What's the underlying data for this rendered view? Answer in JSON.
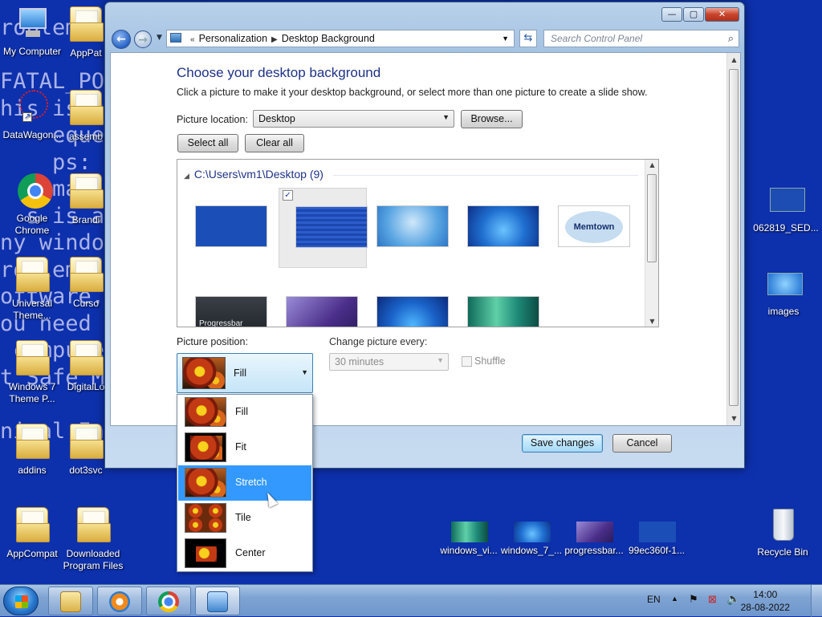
{
  "wallpaper": {
    "lines": [
      "roblem has b              n d           revent",
      "                                           .",
      "FATAL_POO",
      "his is the                                ",
      "    eque you",
      "    ps:",
      "  t ma                                talled.",
      "  s is a                              nufactur",
      "ny windo",
      "roblems co                            rdware",
      "oftware.                              dowing.",
      "ou need t                             estart",
      " c mputer,                            then",
      "t Safe Mode.",
      "",
      "nical Informati"
    ]
  },
  "desktop_icons": [
    {
      "label": "My Computer",
      "icon": "computer-icon"
    },
    {
      "label": "AppPat",
      "icon": "folder-icon"
    },
    {
      "label": "DataWagon...",
      "icon": "shortcut-icon"
    },
    {
      "label": "assemb",
      "icon": "folder-icon"
    },
    {
      "label": "Google Chrome",
      "icon": "chrome-icon"
    },
    {
      "label": "Brandi",
      "icon": "folder-icon"
    },
    {
      "label": "Universal Theme...",
      "icon": "folder-icon"
    },
    {
      "label": "Curso",
      "icon": "folder-icon"
    },
    {
      "label": "Windows 7 Theme P...",
      "icon": "folder-icon"
    },
    {
      "label": "DigitalLo",
      "icon": "folder-icon"
    },
    {
      "label": "addins",
      "icon": "folder-icon"
    },
    {
      "label": "dot3svc",
      "icon": "folder-icon"
    },
    {
      "label": "AppCompat",
      "icon": "folder-icon"
    },
    {
      "label": "Downloaded Program Files",
      "icon": "folder-icon"
    },
    {
      "label": "062819_SED...",
      "icon": "image-file-icon"
    },
    {
      "label": "images",
      "icon": "image-file-icon"
    },
    {
      "label": "windows_vi...",
      "icon": "image-file-icon"
    },
    {
      "label": "windows_7_...",
      "icon": "image-file-icon"
    },
    {
      "label": "progressbar...",
      "icon": "image-file-icon"
    },
    {
      "label": "99ec360f-1...",
      "icon": "image-file-icon"
    },
    {
      "label": "Recycle Bin",
      "icon": "recycle-bin-icon"
    }
  ],
  "window": {
    "breadcrumb": [
      "Personalization",
      "Desktop Background"
    ],
    "search_placeholder": "Search Control Panel",
    "heading": "Choose your desktop background",
    "subtext": "Click a picture to make it your desktop background, or select more than one picture to create a slide show.",
    "picture_location_label": "Picture location:",
    "picture_location_value": "Desktop",
    "browse_label": "Browse...",
    "select_all_label": "Select all",
    "clear_all_label": "Clear all",
    "gallery_group": "C:\\Users\\vm1\\Desktop (9)",
    "gallery_items": [
      {
        "style": "bsod",
        "checked": false
      },
      {
        "style": "bsod2",
        "checked": true
      },
      {
        "style": "blue",
        "checked": false
      },
      {
        "style": "win7",
        "checked": false
      },
      {
        "style": "memtown",
        "checked": false,
        "caption": "Memtown"
      },
      {
        "style": "dark",
        "checked": false,
        "caption": "Progressbar"
      },
      {
        "style": "purple",
        "checked": false
      },
      {
        "style": "win7b",
        "checked": false
      },
      {
        "style": "aurora",
        "checked": false
      }
    ],
    "picture_position_label": "Picture position:",
    "picture_position_value": "Fill",
    "change_picture_label": "Change picture every:",
    "change_picture_value": "30 minutes",
    "shuffle_label": "Shuffle",
    "save_label": "Save changes",
    "cancel_label": "Cancel"
  },
  "position_options": [
    {
      "label": "Fill",
      "highlighted": false
    },
    {
      "label": "Fit",
      "highlighted": false
    },
    {
      "label": "Stretch",
      "highlighted": true
    },
    {
      "label": "Tile",
      "highlighted": false
    },
    {
      "label": "Center",
      "highlighted": false
    }
  ],
  "taskbar": {
    "language": "EN",
    "time": "14:00",
    "date": "28-08-2022",
    "buttons": [
      "explorer-icon",
      "media-player-icon",
      "chrome-icon",
      "control-panel-icon"
    ]
  }
}
